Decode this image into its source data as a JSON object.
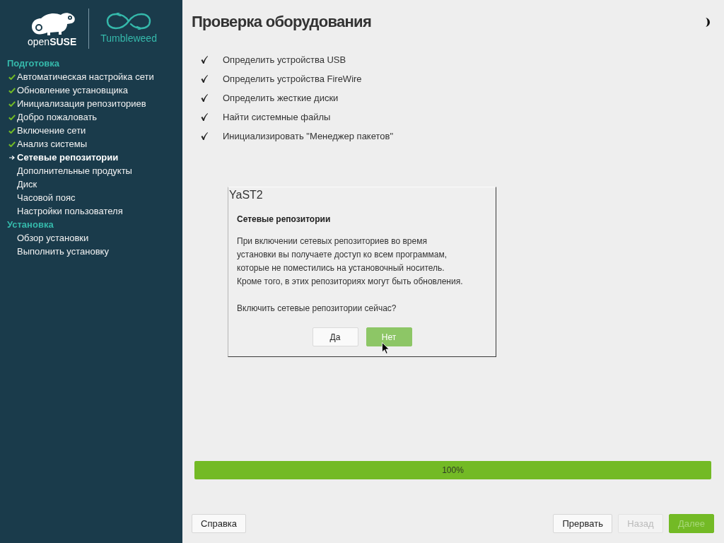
{
  "logo": {
    "brand": "open**SUSE**",
    "product": "Tumbleweed"
  },
  "sidebar": {
    "sections": [
      {
        "title": "Подготовка",
        "items": [
          {
            "label": "Автоматическая настройка сети",
            "done": true,
            "selected": false
          },
          {
            "label": "Обновление установщика",
            "done": true,
            "selected": false
          },
          {
            "label": "Инициализация репозиториев",
            "done": true,
            "selected": false
          },
          {
            "label": "Добро пожаловать",
            "done": true,
            "selected": false
          },
          {
            "label": "Включение сети",
            "done": true,
            "selected": false
          },
          {
            "label": "Анализ системы",
            "done": true,
            "selected": false
          },
          {
            "label": "Сетевые репозитории",
            "done": false,
            "selected": true
          },
          {
            "label": "Дополнительные продукты",
            "done": false,
            "selected": false
          },
          {
            "label": "Диск",
            "done": false,
            "selected": false
          },
          {
            "label": "Часовой пояс",
            "done": false,
            "selected": false
          },
          {
            "label": "Настройки пользователя",
            "done": false,
            "selected": false
          }
        ]
      },
      {
        "title": "Установка",
        "items": [
          {
            "label": "Обзор установки",
            "done": false,
            "selected": false
          },
          {
            "label": "Выполнить установку",
            "done": false,
            "selected": false
          }
        ]
      }
    ]
  },
  "page": {
    "title": "Проверка оборудования",
    "tasks": [
      {
        "label": "Определить устройства USB",
        "checked": true
      },
      {
        "label": "Определить устройства FireWire",
        "checked": true
      },
      {
        "label": "Определить жесткие диски",
        "checked": true
      },
      {
        "label": "Найти системные файлы",
        "checked": true
      },
      {
        "label": "Инициализировать \"Менеджер пакетов\"",
        "checked": true
      }
    ]
  },
  "dialog": {
    "title": "YaST2",
    "heading": "Сетевые репозитории",
    "message": "При включении сетевых репозиториев во время\nустановки вы получаете доступ ко всем программам,\nкоторые не поместились на установочный носитель.\nКроме того, в этих репозиториях могут быть обновления.",
    "question": "Включить сетевые репозитории сейчас?",
    "buttons": [
      {
        "label": "Да",
        "focused": false
      },
      {
        "label": "Нет",
        "focused": true
      }
    ]
  },
  "progress": {
    "level": 1,
    "reading": "100%"
  },
  "footer": {
    "left": [
      {
        "label": "Справка",
        "primary": false,
        "disabled": false
      }
    ],
    "right": [
      {
        "label": "Прервать",
        "primary": false,
        "disabled": false
      },
      {
        "label": "Назад",
        "primary": false,
        "disabled": true
      },
      {
        "label": "Далее",
        "primary": true,
        "disabled": true
      }
    ]
  }
}
